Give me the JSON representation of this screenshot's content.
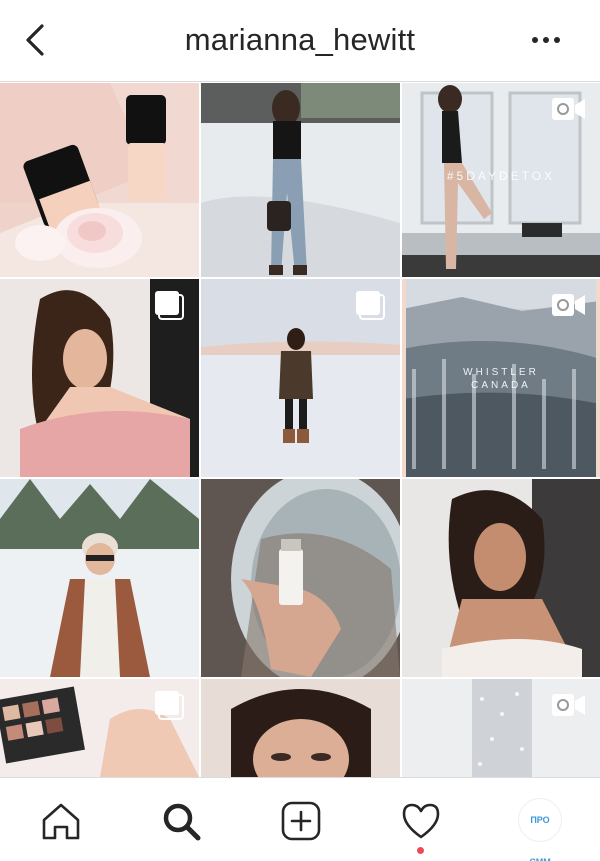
{
  "header": {
    "username": "marianna_hewitt",
    "back_icon": "chevron-left-icon",
    "more_icon": "more-horizontal-icon"
  },
  "grid": {
    "posts": [
      {
        "name": "post-foundation-bottles",
        "badge": ""
      },
      {
        "name": "post-woman-walking-snow",
        "badge": ""
      },
      {
        "name": "post-gym-workout",
        "badge": "video",
        "overlay_text": "#5DAYDETOX"
      },
      {
        "name": "post-woman-pink-sweater",
        "badge": "carousel"
      },
      {
        "name": "post-woman-snowfield",
        "badge": "carousel"
      },
      {
        "name": "post-whistler-forest",
        "badge": "video",
        "overlay_text_line1": "WHISTLER",
        "overlay_text_line2": "CANADA"
      },
      {
        "name": "post-woman-beanie-snow",
        "badge": ""
      },
      {
        "name": "post-perfume-airplane",
        "badge": ""
      },
      {
        "name": "post-woman-portrait",
        "badge": ""
      },
      {
        "name": "post-eyeshadow-palette",
        "badge": "carousel"
      },
      {
        "name": "post-woman-makeup",
        "badge": ""
      },
      {
        "name": "post-glitter-bottle",
        "badge": "video"
      }
    ]
  },
  "tabbar": {
    "home_icon": "home-icon",
    "search_icon": "search-icon",
    "add_icon": "add-post-icon",
    "activity_icon": "heart-icon",
    "profile_label": "ПРО СММ",
    "activity_has_notification": true
  },
  "colors": {
    "border": "#dbdbdb",
    "text": "#262626",
    "notification": "#ed4956",
    "profile_text": "#3a9ad9"
  }
}
